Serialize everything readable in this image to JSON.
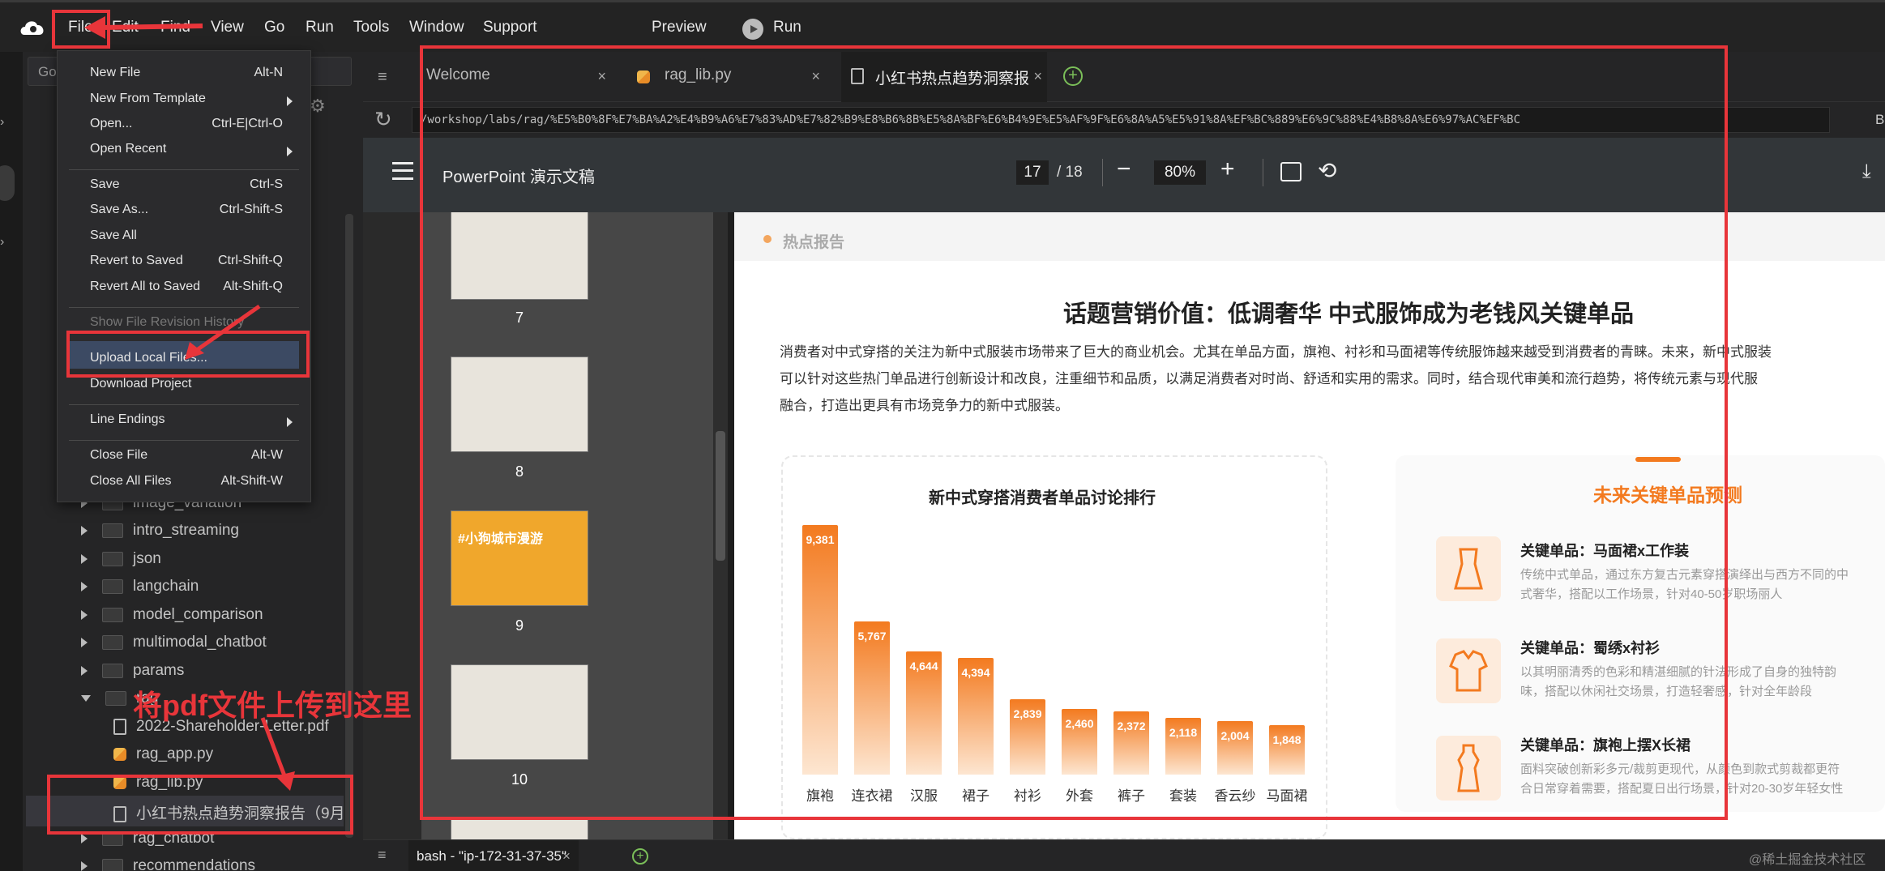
{
  "menubar": {
    "items": [
      "File",
      "Edit",
      "Find",
      "View",
      "Go",
      "Run",
      "Tools",
      "Window",
      "Support"
    ],
    "preview_label": "Preview",
    "run_label": "Run"
  },
  "file_menu": {
    "items": [
      {
        "label": "New File",
        "shortcut": "Alt-N"
      },
      {
        "label": "New From Template",
        "shortcut": ""
      },
      {
        "label": "Open...",
        "shortcut": "Ctrl-E|Ctrl-O"
      },
      {
        "label": "Open Recent",
        "shortcut": ""
      },
      {
        "label": "Save",
        "shortcut": "Ctrl-S"
      },
      {
        "label": "Save As...",
        "shortcut": "Ctrl-Shift-S"
      },
      {
        "label": "Save All",
        "shortcut": ""
      },
      {
        "label": "Revert to Saved",
        "shortcut": "Ctrl-Shift-Q"
      },
      {
        "label": "Revert All to Saved",
        "shortcut": "Alt-Shift-Q"
      },
      {
        "label": "Show File Revision History",
        "shortcut": ""
      },
      {
        "label": "Upload Local Files...",
        "shortcut": ""
      },
      {
        "label": "Download Project",
        "shortcut": ""
      },
      {
        "label": "Line Endings",
        "shortcut": ""
      },
      {
        "label": "Close File",
        "shortcut": "Alt-W"
      },
      {
        "label": "Close All Files",
        "shortcut": "Alt-Shift-W"
      }
    ]
  },
  "search_placeholder": "Go",
  "tree": {
    "items": [
      {
        "label": "image_variation",
        "type": "folder"
      },
      {
        "label": "intro_streaming",
        "type": "folder"
      },
      {
        "label": "json",
        "type": "folder"
      },
      {
        "label": "langchain",
        "type": "folder"
      },
      {
        "label": "model_comparison",
        "type": "folder"
      },
      {
        "label": "multimodal_chatbot",
        "type": "folder"
      },
      {
        "label": "params",
        "type": "folder"
      },
      {
        "label": "rag",
        "type": "folder-open"
      },
      {
        "label": "2022-Shareholder-Letter.pdf",
        "type": "pdf"
      },
      {
        "label": "rag_app.py",
        "type": "py"
      },
      {
        "label": "rag_lib.py",
        "type": "py"
      },
      {
        "label": "小红书热点趋势洞察报告（9月",
        "type": "pdf"
      },
      {
        "label": "rag_chatbot",
        "type": "folder"
      },
      {
        "label": "recommendations",
        "type": "folder"
      }
    ]
  },
  "annotation": "将pdf文件上传到这里",
  "tabs": [
    {
      "label": "Welcome"
    },
    {
      "label": "rag_lib.py"
    },
    {
      "label": "小红书热点趋势洞察报"
    }
  ],
  "url": "/workshop/labs/rag/%E5%B0%8F%E7%BA%A2%E4%B9%A6%E7%83%AD%E7%82%B9%E8%B6%8B%E5%8A%BF%E6%B4%9E%E5%AF%9F%E6%8A%A5%E5%91%8A%EF%BC%889%E6%9C%88%E4%B8%8A%E6%97%AC%EF%BC",
  "url_right_label": "B",
  "pdf": {
    "title": "PowerPoint 演示文稿",
    "page_current": "17",
    "page_total": "/ 18",
    "zoom": "80%",
    "thumbnails": [
      "7",
      "8",
      "9",
      "10"
    ],
    "thumb9_text": "#小狗城市漫游"
  },
  "slide": {
    "tag": "热点报告",
    "heading": "话题营销价值：低调奢华 中式服饰成为老钱风关键单品",
    "paragraph_lines": [
      "消费者对中式穿搭的关注为新中式服装市场带来了巨大的商业机会。尤其在单品方面，旗袍、衬衫和马面裙等传统服饰越来越受到消费者的青睐。未来，新中式服装",
      "可以针对这些热门单品进行创新设计和改良，注重细节和品质，以满足消费者对时尚、舒适和实用的需求。同时，结合现代审美和流行趋势，将传统元素与现代服",
      "融合，打造出更具有市场竞争力的新中式服装。"
    ],
    "right_title": "未来关键单品预测",
    "predictions": [
      {
        "title": "关键单品：马面裙x工作装",
        "line1": "传统中式单品，通过东方复古元素穿搭演绎出与西方不同的中",
        "line2": "式奢华，搭配以工作场景，针对40-50岁职场丽人"
      },
      {
        "title": "关键单品：蜀绣x衬衫",
        "line1": "以其明丽清秀的色彩和精湛细腻的针法形成了自身的独特韵",
        "line2": "味，搭配以休闲社交场景，打造轻奢感，针对全年龄段"
      },
      {
        "title": "关键单品：旗袍上摆X长裙",
        "line1": "面料突破创新彩多元/裁剪更现代，从颜色到款式剪裁都更符",
        "line2": "合日常穿着需要，搭配夏日出行场景，针对20-30岁年轻女性"
      }
    ]
  },
  "chart_data": {
    "type": "bar",
    "title": "新中式穿搭消费者单品讨论排行",
    "categories": [
      "旗袍",
      "连衣裙",
      "汉服",
      "裙子",
      "衬衫",
      "外套",
      "裤子",
      "套装",
      "香云纱",
      "马面裙"
    ],
    "values": [
      9381,
      5767,
      4644,
      4394,
      2839,
      2460,
      2372,
      2118,
      2004,
      1848
    ],
    "value_labels": [
      "9,381",
      "5,767",
      "4,644",
      "4,394",
      "2,839",
      "2,460",
      "2,372",
      "2,118",
      "2,004",
      "1,848"
    ],
    "color": "#f37a1f"
  },
  "terminal_tab": "bash - \"ip-172-31-37-35\"",
  "watermark": "@稀土掘金技术社区"
}
